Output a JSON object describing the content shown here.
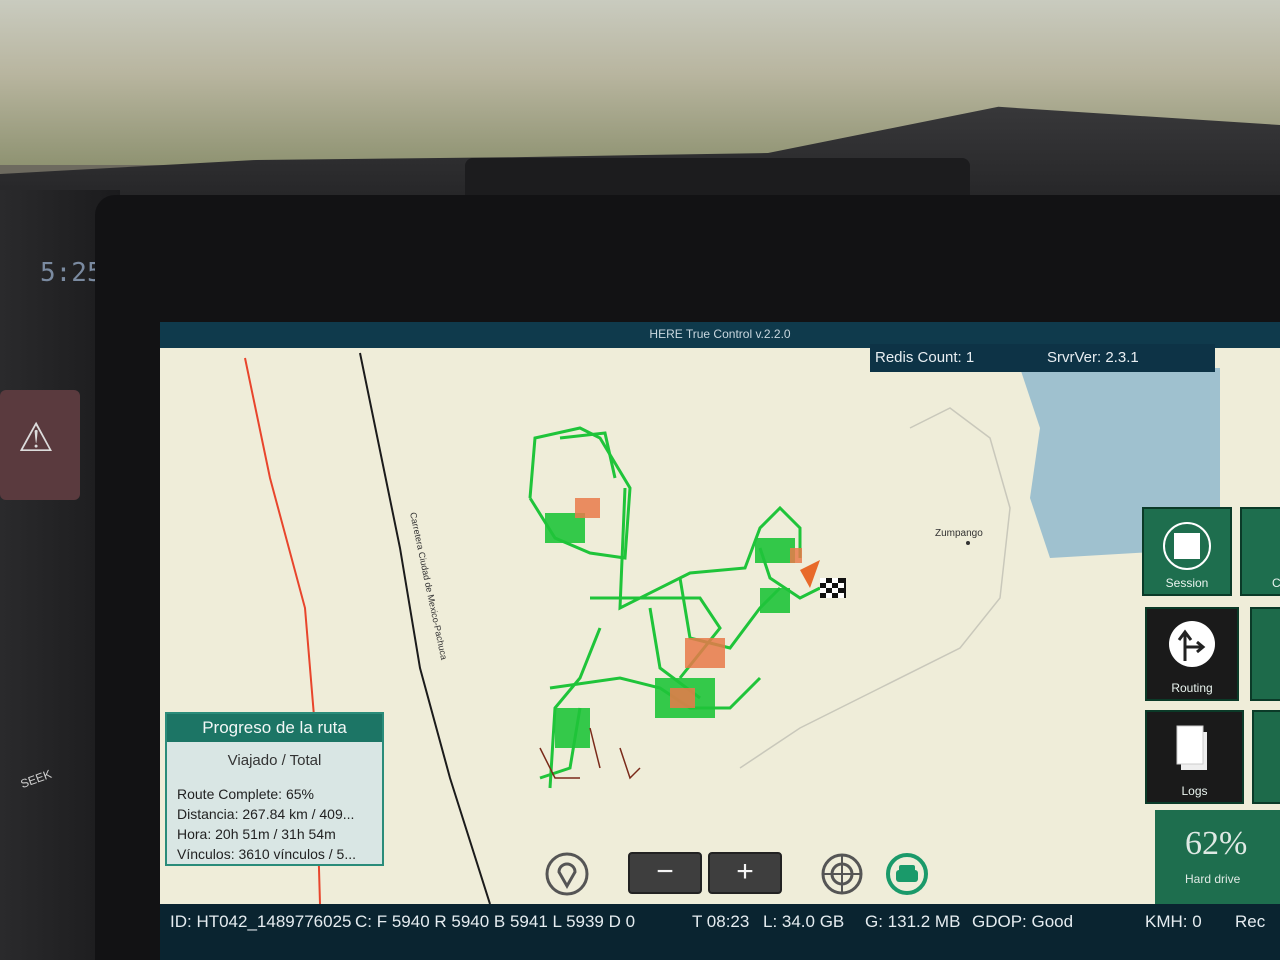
{
  "car": {
    "dash_clock": "5:25",
    "seek_label": "SEEK"
  },
  "app": {
    "title": "HERE True Control v.2.2.0"
  },
  "status_top": {
    "redis": "Redis Count: 1",
    "server": "SrvrVer: 2.3.1"
  },
  "map": {
    "road_label": "Carretera Ciudad de Mexico-Pachuca",
    "town_label": "Zumpango"
  },
  "side_buttons": {
    "session": "Session",
    "routing": "Routing",
    "logs": "Logs",
    "extra": "C"
  },
  "disk": {
    "percent": "62%",
    "label": "Hard drive"
  },
  "progress": {
    "title": "Progreso de la ruta",
    "subtitle": "Viajado / Total",
    "route_complete": "Route Complete: 65%",
    "distance": "Distancia: 267.84 km / 409...",
    "time": "Hora: 20h 51m / 31h 54m",
    "links": "Vínculos: 3610 vínculos / 5..."
  },
  "zoom": {
    "out": "−",
    "in": "+"
  },
  "footer": {
    "id": "ID: HT042_1489776025",
    "counts": "C: F 5940 R 5940 B 5941 L 5939 D 0",
    "time": "T 08:23",
    "storage": "L:  34.0 GB",
    "memory": "G: 131.2 MB",
    "gdop": "GDOP: Good",
    "speed": "KMH: 0",
    "rec": "Rec"
  },
  "colors": {
    "route_green": "#1fc43a",
    "road_red": "#e8452c",
    "panel_teal": "#1c7565",
    "button_green": "#1e6e4e"
  }
}
